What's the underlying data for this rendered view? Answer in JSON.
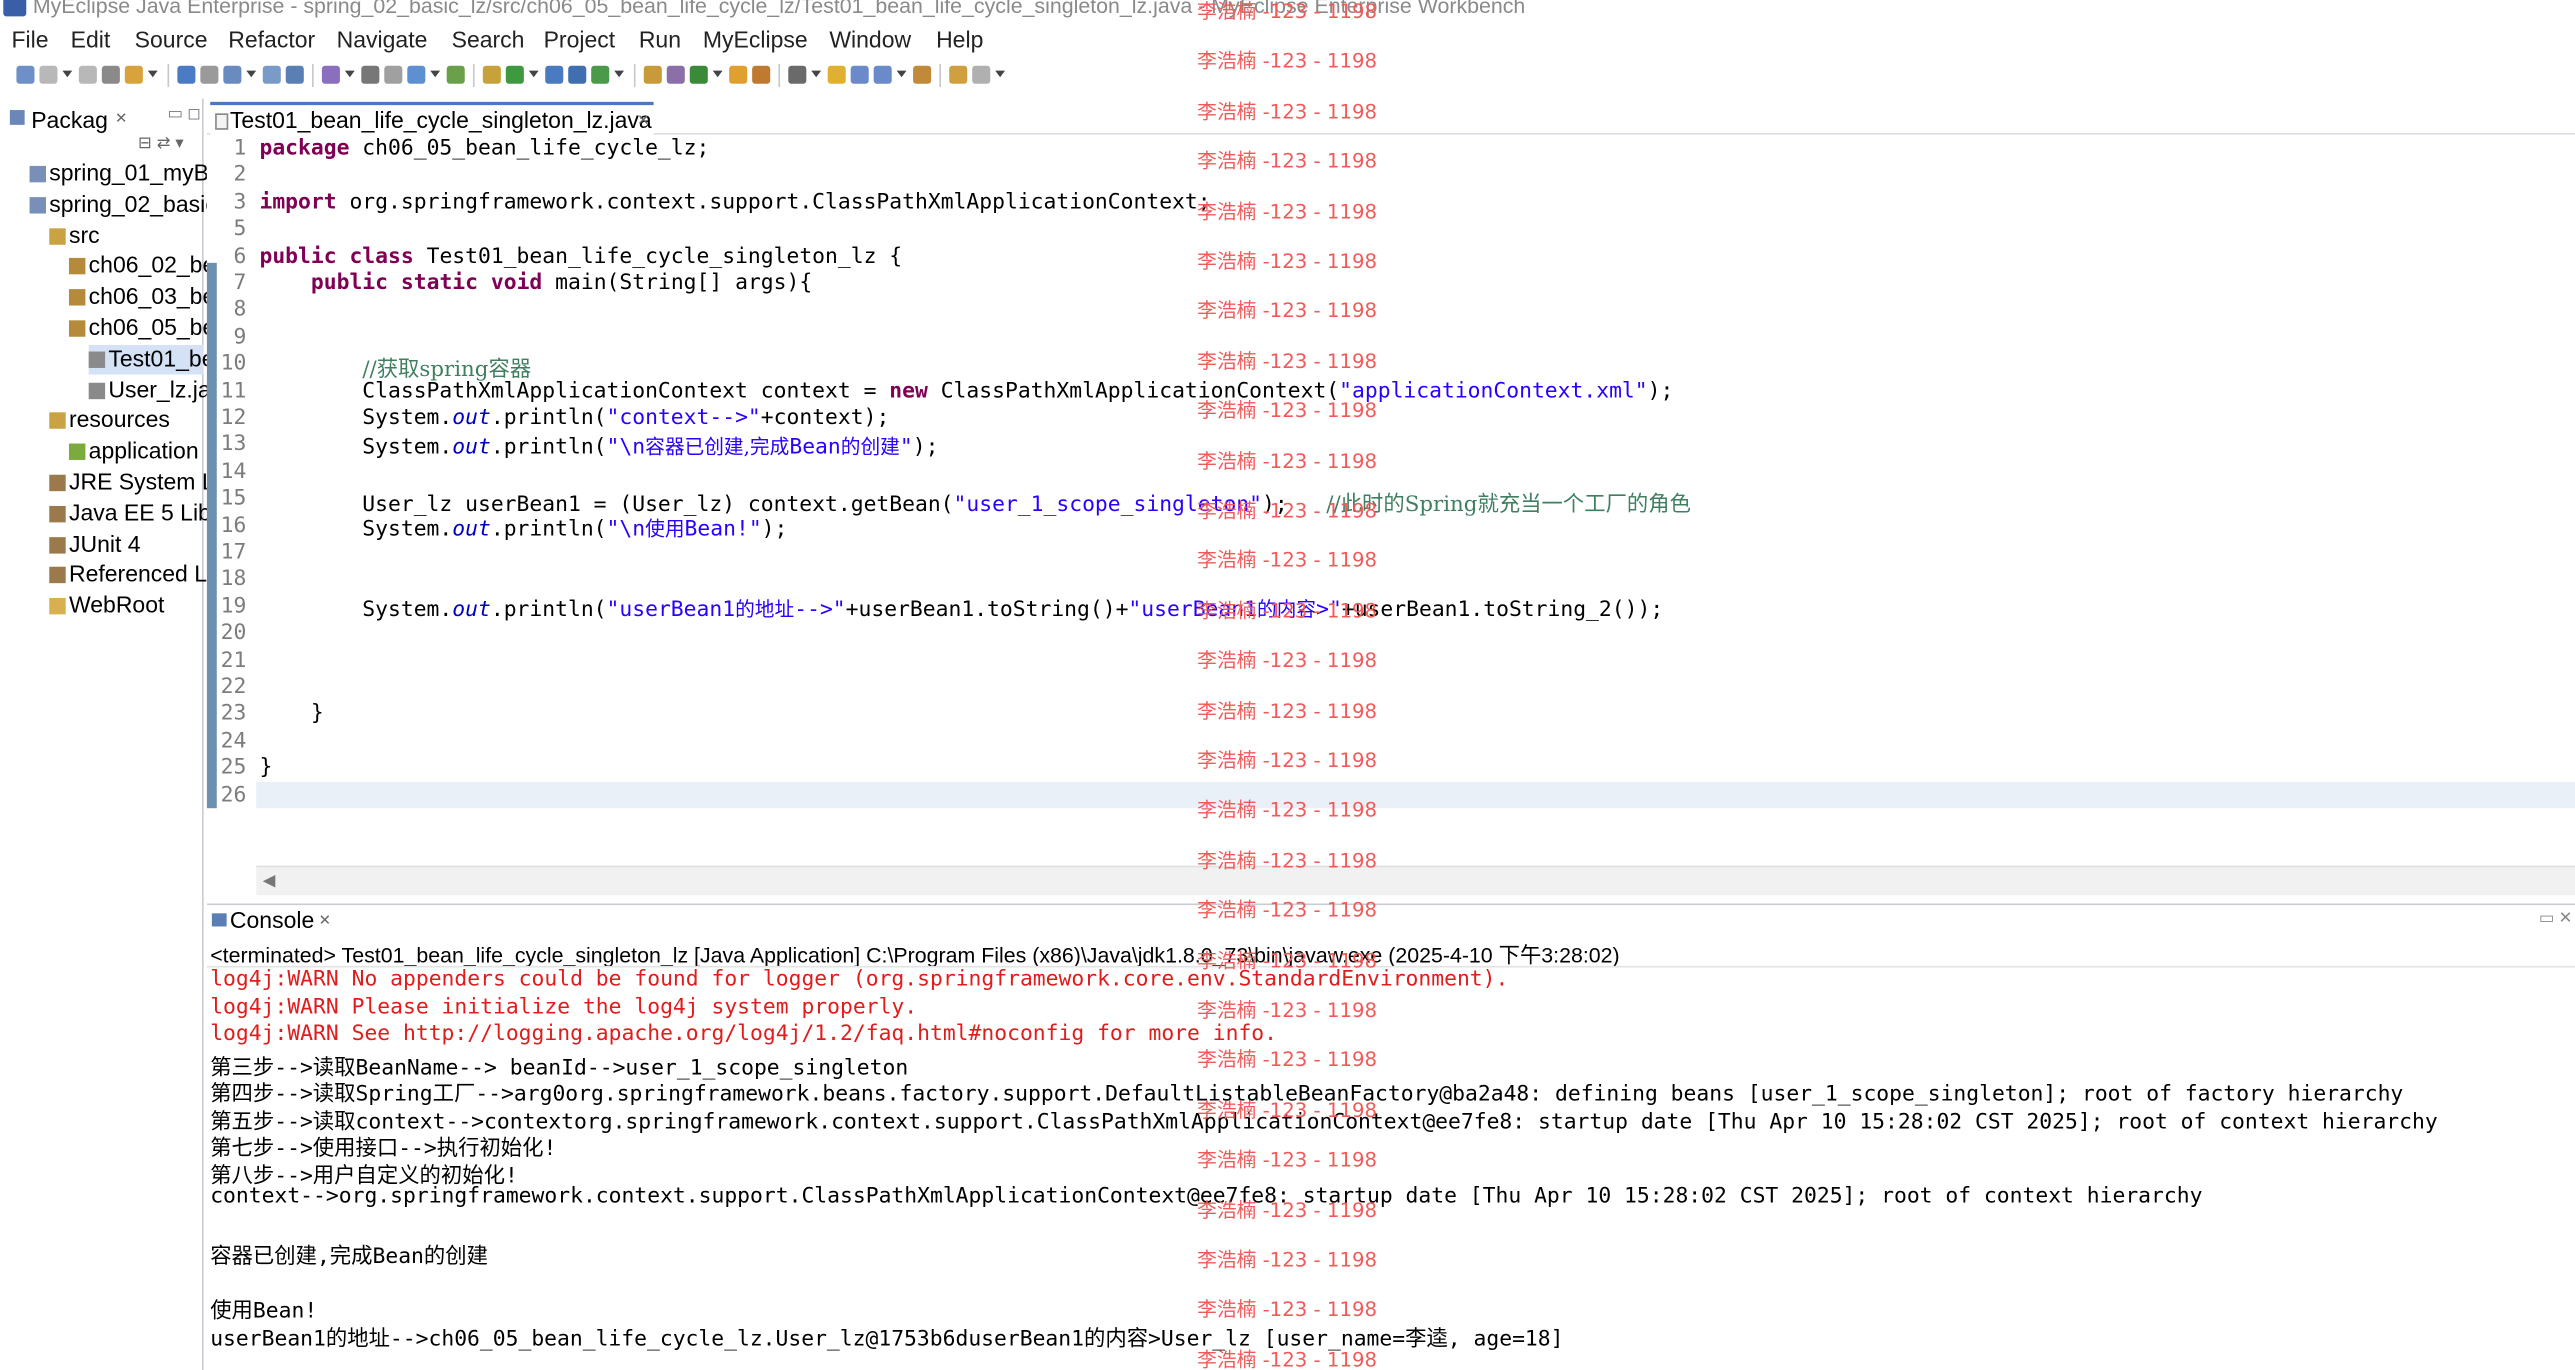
{
  "window": {
    "title": "MyEclipse Java Enterprise - spring_02_basic_lz/src/ch06_05_bean_life_cycle_lz/Test01_bean_life_cycle_singleton_lz.java - MyEclipse Enterprise Workbench"
  },
  "menu": [
    "File",
    "Edit",
    "Source",
    "Refactor",
    "Navigate",
    "Search",
    "Project",
    "Run",
    "MyEclipse",
    "Window",
    "Help"
  ],
  "package_explorer": {
    "tab_label": "Packag",
    "items": [
      {
        "label": "spring_01_myB",
        "icon": "project-icon"
      },
      {
        "label": "spring_02_basic",
        "icon": "project-icon"
      },
      {
        "label": "src",
        "icon": "source-folder-icon"
      },
      {
        "label": "ch06_02_be",
        "icon": "package-icon"
      },
      {
        "label": "ch06_03_be",
        "icon": "package-icon"
      },
      {
        "label": "ch06_05_be",
        "icon": "package-icon"
      },
      {
        "label": "Test01_be",
        "icon": "java-file-icon"
      },
      {
        "label": "User_lz.ja",
        "icon": "java-file-icon"
      },
      {
        "label": "resources",
        "icon": "source-folder-icon"
      },
      {
        "label": "application",
        "icon": "xml-file-icon"
      },
      {
        "label": "JRE System L",
        "icon": "library-icon"
      },
      {
        "label": "Java EE 5 Libr",
        "icon": "library-icon"
      },
      {
        "label": "JUnit 4",
        "icon": "library-icon"
      },
      {
        "label": "Referenced L",
        "icon": "library-icon"
      },
      {
        "label": "WebRoot",
        "icon": "folder-icon"
      }
    ]
  },
  "editor": {
    "tab_label": "Test01_bean_life_cycle_singleton_lz.java",
    "code_lines": [
      {
        "n": "1",
        "segs": [
          [
            "kw",
            "package"
          ],
          [
            "",
            " ch06_05_bean_life_cycle_lz;"
          ]
        ]
      },
      {
        "n": "2",
        "segs": []
      },
      {
        "n": "3",
        "segs": [
          [
            "kw",
            "import"
          ],
          [
            "",
            " org.springframework.context.support.ClassPathXmlApplicationContext;"
          ]
        ]
      },
      {
        "n": "5",
        "segs": []
      },
      {
        "n": "6",
        "segs": [
          [
            "kw",
            "public"
          ],
          [
            "",
            " "
          ],
          [
            "kw",
            "class"
          ],
          [
            "",
            " Test01_bean_life_cycle_singleton_lz {"
          ]
        ]
      },
      {
        "n": "7",
        "segs": [
          [
            "",
            "    "
          ],
          [
            "kw",
            "public"
          ],
          [
            "",
            " "
          ],
          [
            "kw",
            "static"
          ],
          [
            "",
            " "
          ],
          [
            "kw",
            "void"
          ],
          [
            "",
            " main(String[] args){"
          ]
        ]
      },
      {
        "n": "8",
        "segs": []
      },
      {
        "n": "9",
        "segs": []
      },
      {
        "n": "10",
        "segs": [
          [
            "",
            "        "
          ],
          [
            "cmt",
            "//获取spring容器"
          ]
        ]
      },
      {
        "n": "11",
        "segs": [
          [
            "",
            "        ClassPathXmlApplicationContext context = "
          ],
          [
            "kw",
            "new"
          ],
          [
            "",
            " ClassPathXmlApplicationContext("
          ],
          [
            "str",
            "\"applicationContext.xml\""
          ],
          [
            "",
            ");"
          ]
        ]
      },
      {
        "n": "12",
        "segs": [
          [
            "",
            "        System."
          ],
          [
            "fld",
            "out"
          ],
          [
            "",
            ".println("
          ],
          [
            "str",
            "\"context-->\""
          ],
          [
            "",
            "+context);"
          ]
        ]
      },
      {
        "n": "13",
        "segs": [
          [
            "",
            "        System."
          ],
          [
            "fld",
            "out"
          ],
          [
            "",
            ".println("
          ],
          [
            "str",
            "\"\\n"
          ],
          [
            "strcn",
            "容器已创建,完成"
          ],
          [
            "str",
            "Bean"
          ],
          [
            "strcn",
            "的创建"
          ],
          [
            "str",
            "\""
          ],
          [
            "",
            ");"
          ]
        ]
      },
      {
        "n": "14",
        "segs": []
      },
      {
        "n": "15",
        "segs": [
          [
            "",
            "        User_lz userBean1 = (User_lz) context.getBean("
          ],
          [
            "str",
            "\"user_1_scope_singleton\""
          ],
          [
            "",
            ");   "
          ],
          [
            "cmt",
            "//此时的Spring就充当一个工厂的角色"
          ]
        ]
      },
      {
        "n": "16",
        "segs": [
          [
            "",
            "        System."
          ],
          [
            "fld",
            "out"
          ],
          [
            "",
            ".println("
          ],
          [
            "str",
            "\"\\n"
          ],
          [
            "strcn",
            "使用"
          ],
          [
            "str",
            "Bean!\""
          ],
          [
            "",
            ");"
          ]
        ]
      },
      {
        "n": "17",
        "segs": []
      },
      {
        "n": "18",
        "segs": []
      },
      {
        "n": "19",
        "segs": [
          [
            "",
            "        System."
          ],
          [
            "fld",
            "out"
          ],
          [
            "",
            ".println("
          ],
          [
            "str",
            "\"userBean1"
          ],
          [
            "strcn",
            "的地址"
          ],
          [
            "str",
            "-->\""
          ],
          [
            "",
            "+userBean1.toString()+"
          ],
          [
            "str",
            "\"userBean1"
          ],
          [
            "strcn",
            "的内容"
          ],
          [
            "str",
            ">\""
          ],
          [
            "",
            "+userBean1.toString_2());"
          ]
        ]
      },
      {
        "n": "20",
        "segs": []
      },
      {
        "n": "21",
        "segs": []
      },
      {
        "n": "22",
        "segs": []
      },
      {
        "n": "23",
        "segs": [
          [
            "",
            "    }"
          ]
        ]
      },
      {
        "n": "24",
        "segs": []
      },
      {
        "n": "25",
        "segs": [
          [
            "",
            "}"
          ]
        ]
      },
      {
        "n": "26",
        "segs": []
      }
    ]
  },
  "console": {
    "tab_label": "Console",
    "status": "<terminated> Test01_bean_life_cycle_singleton_lz [Java Application] C:\\Program Files (x86)\\Java\\jdk1.8.0_73\\bin\\javaw.exe (2025-4-10 下午3:28:02)",
    "lines": [
      {
        "kind": "err",
        "text": "log4j:WARN No appenders could be found for logger (org.springframework.core.env.StandardEnvironment)."
      },
      {
        "kind": "err",
        "text": "log4j:WARN Please initialize the log4j system properly."
      },
      {
        "kind": "err",
        "text": "log4j:WARN See http://logging.apache.org/log4j/1.2/faq.html#noconfig for more info."
      },
      {
        "kind": "out",
        "text": "第三步-->读取BeanName--> beanId-->user_1_scope_singleton"
      },
      {
        "kind": "out",
        "text": "第四步-->读取Spring工厂-->arg0org.springframework.beans.factory.support.DefaultListableBeanFactory@ba2a48: defining beans [user_1_scope_singleton]; root of factory hierarchy"
      },
      {
        "kind": "out",
        "text": "第五步-->读取context-->contextorg.springframework.context.support.ClassPathXmlApplicationContext@ee7fe8: startup date [Thu Apr 10 15:28:02 CST 2025]; root of context hierarchy"
      },
      {
        "kind": "out",
        "text": "第七步-->使用接口-->执行初始化!"
      },
      {
        "kind": "out",
        "text": "第八步-->用户自定义的初始化!"
      },
      {
        "kind": "out",
        "text": "context-->org.springframework.context.support.ClassPathXmlApplicationContext@ee7fe8: startup date [Thu Apr 10 15:28:02 CST 2025]; root of context hierarchy"
      },
      {
        "kind": "out",
        "text": ""
      },
      {
        "kind": "out",
        "text": "容器已创建,完成Bean的创建"
      },
      {
        "kind": "out",
        "text": ""
      },
      {
        "kind": "out",
        "text": "使用Bean!"
      },
      {
        "kind": "out",
        "text": "userBean1的地址-->ch06_05_bean_life_cycle_lz.User_lz@1753b6duserBean1的内容>User_lz [user_name=李逵, age=18]"
      }
    ]
  },
  "watermark": {
    "text": "李浩楠 -123 - 1198",
    "count": 28,
    "color": "#f25a5a"
  },
  "colors": {
    "keyword": "#7f0055",
    "string": "#2a00ff",
    "comment": "#3f7f5f",
    "field": "#0000c0",
    "error": "#e01c1c"
  }
}
